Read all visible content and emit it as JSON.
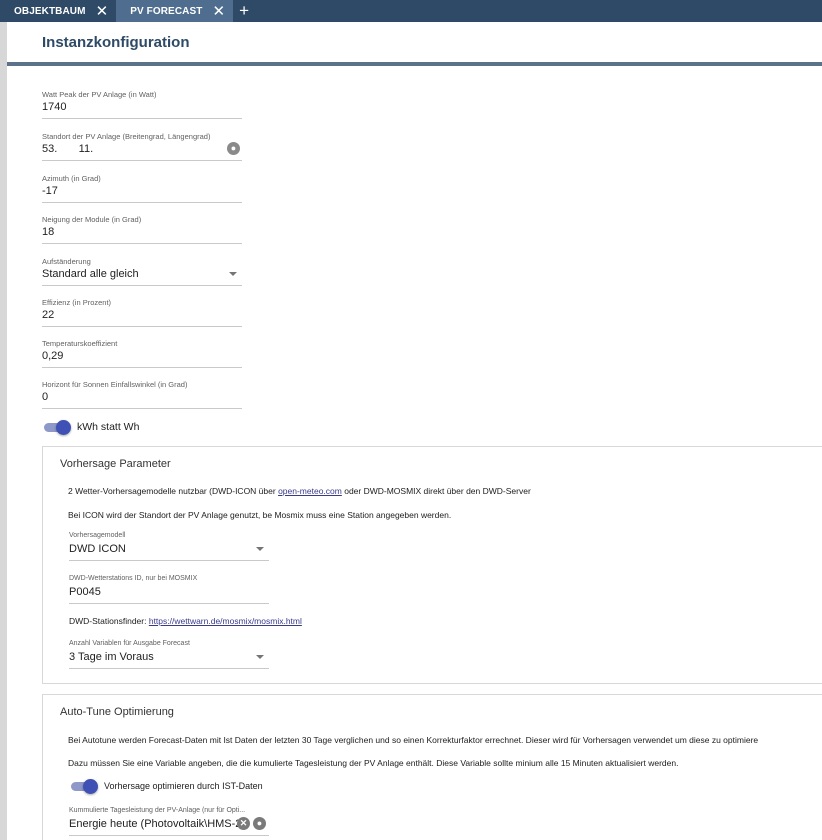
{
  "tabs": [
    {
      "label": "OBJEKTBAUM",
      "close": "✕"
    },
    {
      "label": "PV FORECAST",
      "close": "✕"
    }
  ],
  "tab_add": "+",
  "header": {
    "title": "Instanzkonfiguration"
  },
  "fields": {
    "watt_peak": {
      "label": "Watt Peak der PV Anlage (in Watt)",
      "value": "1740"
    },
    "standort": {
      "label": "Standort der PV Anlage (Breitengrad, Längengrad)",
      "value": "53.       11."
    },
    "azimuth": {
      "label": "Azimuth (in Grad)",
      "value": "-17"
    },
    "neigung": {
      "label": "Neigung der Module (in Grad)",
      "value": "18"
    },
    "aufstaenderung": {
      "label": "Aufständerung",
      "value": "Standard alle gleich"
    },
    "effizienz": {
      "label": "Effizienz (in Prozent)",
      "value": "22"
    },
    "temperatur": {
      "label": "Temperaturskoeffizient",
      "value": "0,29"
    },
    "horizont": {
      "label": "Horizont für Sonnen Einfallswinkel (in Grad)",
      "value": "0"
    }
  },
  "toggle_kwh": {
    "label": "kWh statt Wh",
    "on": true
  },
  "vorhersage": {
    "title": "Vorhersage Parameter",
    "text1_prefix": "2 Wetter-Vorhersagemodelle nutzbar (DWD-ICON über ",
    "text1_link": "open-meteo.com",
    "text1_suffix": " oder DWD-MOSMIX direkt über den DWD-Server",
    "text2": "Bei ICON wird der Standort der PV Anlage genutzt, be Mosmix muss eine Station angegeben werden.",
    "modell": {
      "label": "Vorhersagemodell",
      "value": "DWD ICON"
    },
    "station": {
      "label": "DWD-Wetterstations ID, nur bei MOSMIX",
      "value": "P0045"
    },
    "finder_prefix": "DWD-Stationsfinder: ",
    "finder_link": "https://wettwarn.de/mosmix/mosmix.html",
    "anzahl": {
      "label": "Anzahl Variablen für Ausgabe Forecast",
      "value": "3 Tage im Voraus"
    }
  },
  "autotune": {
    "title": "Auto-Tune Optimierung",
    "text1": "Bei Autotune werden Forecast-Daten mit Ist Daten der letzten 30 Tage verglichen und so einen Korrekturfaktor errechnet. Dieser wird für Vorhersagen verwendet um diese zu optimiere",
    "text2": "Dazu müssen Sie eine Variable angeben, die die kumulierte Tagesleistung der PV Anlage enthält. Diese Variable sollte minium alle 15 Minuten aktualisiert werden.",
    "toggle_label": "Vorhersage optimieren durch IST-Daten",
    "kumuliert": {
      "label": "Kummulierte Tagesleistung der PV-Anlage (nur für Opti...",
      "value": "Energie heute (Photovoltaik\\HMS-2("
    }
  }
}
